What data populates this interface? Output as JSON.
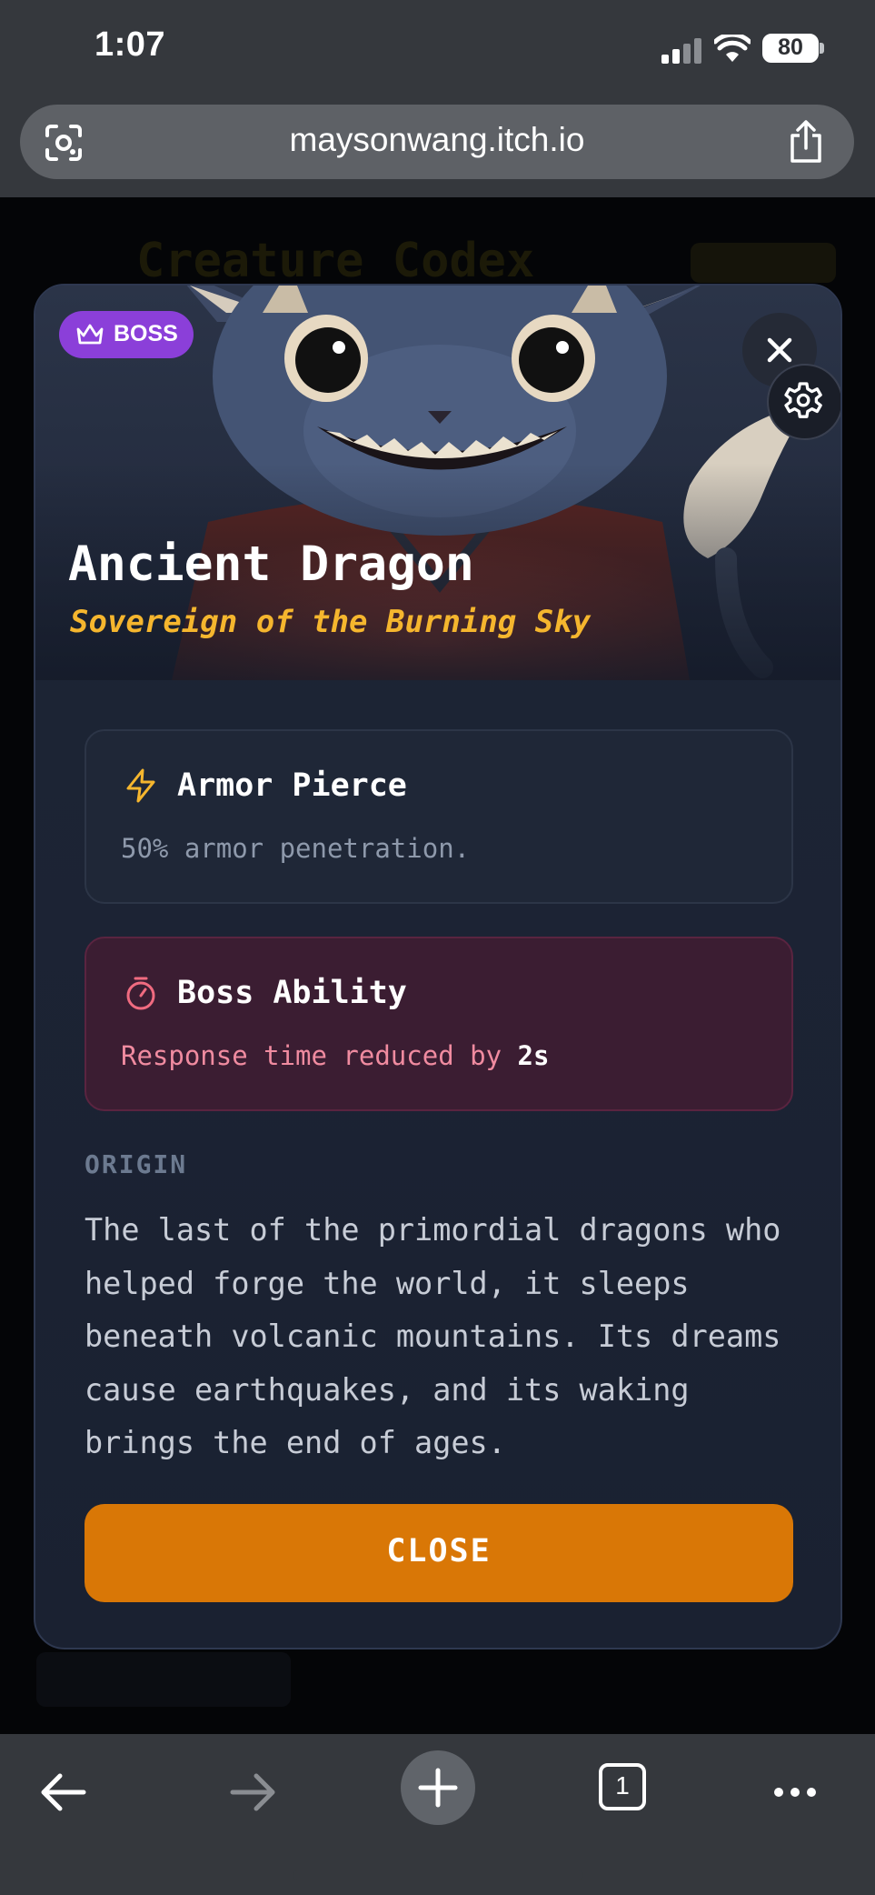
{
  "status_bar": {
    "time": "1:07",
    "battery": "80"
  },
  "browser": {
    "url": "maysonwang.itch.io"
  },
  "background_page": {
    "title": "Creature Codex"
  },
  "modal": {
    "badge": "BOSS",
    "name": "Ancient Dragon",
    "title": "Sovereign of the Burning Sky",
    "ability": {
      "name": "Armor Pierce",
      "description": "50% armor penetration."
    },
    "boss_ability": {
      "name": "Boss Ability",
      "description_prefix": "Response time reduced by",
      "value": "2s"
    },
    "origin_label": "ORIGIN",
    "origin_text": "The last of the primordial dragons who helped forge the world, it sleeps beneath volcanic mountains. Its dreams cause earthquakes, and its waking brings the end of ages.",
    "close_label": "CLOSE"
  },
  "toolbar": {
    "tab_count": "1"
  },
  "colors": {
    "accent_orange": "#d97706",
    "badge_purple": "#8b3fd9",
    "title_gold": "#f5b62e",
    "boss_pink": "#f08ba0"
  },
  "icons": [
    "lens-icon",
    "share-icon",
    "crown-icon",
    "close-icon",
    "gear-icon",
    "lightning-icon",
    "timer-icon",
    "back-arrow-icon",
    "forward-arrow-icon",
    "plus-icon",
    "more-icon"
  ]
}
